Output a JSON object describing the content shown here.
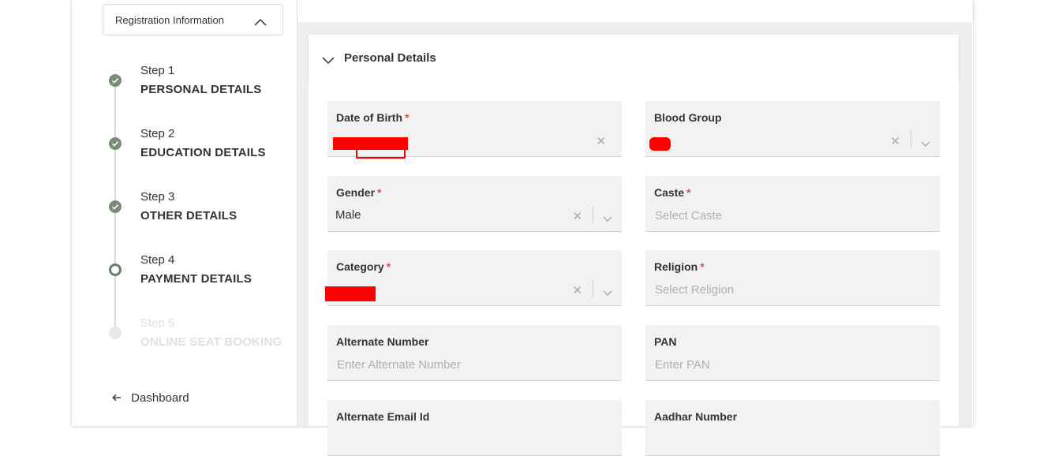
{
  "sidebar": {
    "section_toggle": "Registration Information",
    "steps": [
      {
        "number": "Step 1",
        "title": "PERSONAL DETAILS",
        "status": "completed"
      },
      {
        "number": "Step 2",
        "title": "EDUCATION DETAILS",
        "status": "completed"
      },
      {
        "number": "Step 3",
        "title": "OTHER DETAILS",
        "status": "completed"
      },
      {
        "number": "Step 4",
        "title": "PAYMENT DETAILS",
        "status": "current"
      },
      {
        "number": "Step 5",
        "title": "ONLINE SEAT BOOKING",
        "status": "disabled"
      }
    ],
    "back_link": "Dashboard"
  },
  "section": {
    "title": "Personal Details",
    "expanded": true
  },
  "fields": {
    "dob": {
      "label": "Date of Birth",
      "required": "*",
      "value": "",
      "redacted": true
    },
    "blood_group": {
      "label": "Blood Group",
      "value": "",
      "redacted": true
    },
    "gender": {
      "label": "Gender",
      "required": "*",
      "value": "Male"
    },
    "caste": {
      "label": "Caste",
      "required": "*",
      "placeholder": "Select Caste"
    },
    "category": {
      "label": "Category",
      "required": "*",
      "value": "",
      "redacted": true
    },
    "religion": {
      "label": "Religion",
      "required": "*",
      "placeholder": "Select Religion"
    },
    "alt_number": {
      "label": "Alternate Number",
      "placeholder": "Enter Alternate Number"
    },
    "pan": {
      "label": "PAN",
      "placeholder": "Enter PAN"
    },
    "alt_email": {
      "label": "Alternate Email Id"
    },
    "aadhar": {
      "label": "Aadhar Number"
    }
  },
  "colors": {
    "step_done": "#7b8c7b",
    "required": "#d9534f",
    "redaction": "#ff0000",
    "field_bg": "#f2f2f2",
    "content_bg": "#efefef"
  },
  "icons": {
    "section_toggle": "chevron-up-icon",
    "card_toggle": "chevron-down-icon",
    "clear": "close-icon",
    "dropdown": "chevron-down-icon",
    "back": "arrow-left-icon"
  }
}
